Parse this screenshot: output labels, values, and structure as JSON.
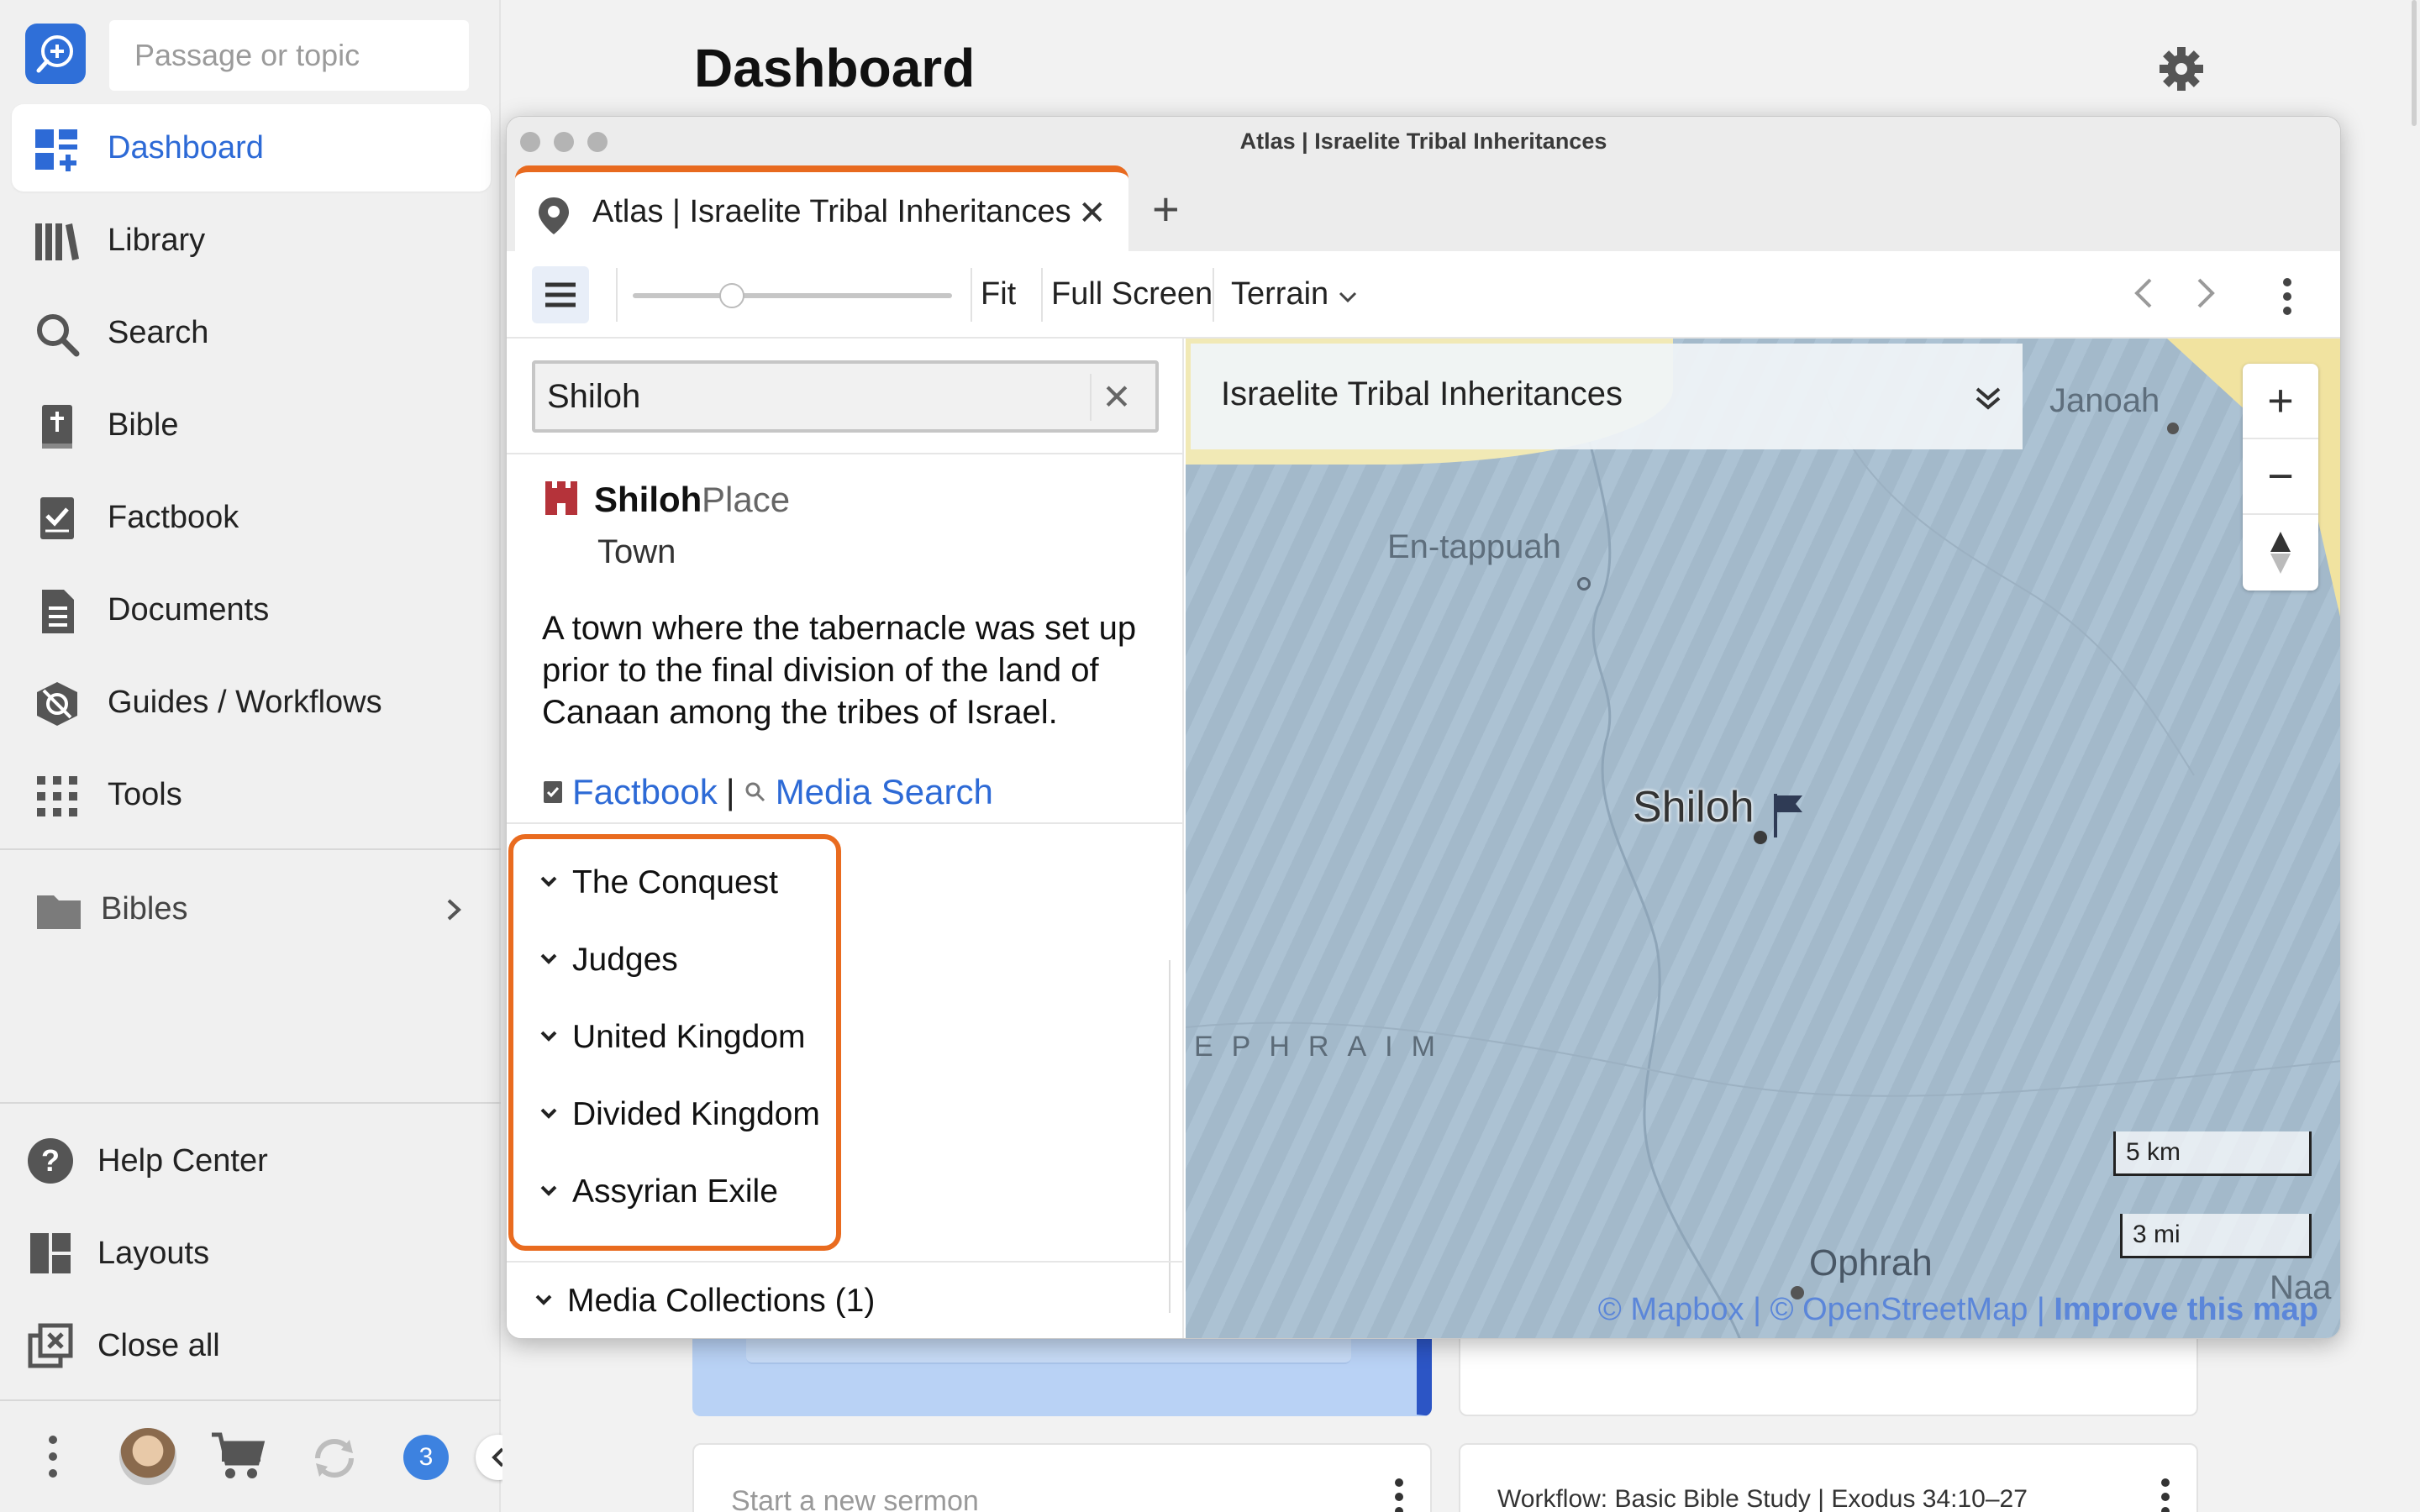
{
  "sidebar": {
    "search_placeholder": "Passage or topic",
    "nav": [
      {
        "label": "Dashboard",
        "icon": "dashboard-icon",
        "active": true
      },
      {
        "label": "Library",
        "icon": "library-icon"
      },
      {
        "label": "Search",
        "icon": "search-icon"
      },
      {
        "label": "Bible",
        "icon": "bible-icon"
      },
      {
        "label": "Factbook",
        "icon": "factbook-icon"
      },
      {
        "label": "Documents",
        "icon": "documents-icon"
      },
      {
        "label": "Guides / Workflows",
        "icon": "guides-icon"
      },
      {
        "label": "Tools",
        "icon": "tools-icon"
      }
    ],
    "bibles_label": "Bibles",
    "bottom": [
      {
        "label": "Help Center",
        "icon": "help-icon"
      },
      {
        "label": "Layouts",
        "icon": "layouts-icon"
      },
      {
        "label": "Close all",
        "icon": "close-all-icon"
      }
    ],
    "notification_count": "3"
  },
  "main": {
    "title": "Dashboard",
    "cards": {
      "sermon_placeholder": "Start a new sermon",
      "workflow_label": "Workflow: Basic Bible Study | Exodus 34:10–27"
    }
  },
  "atlas": {
    "window_title": "Atlas | Israelite Tribal Inheritances",
    "tab_label": "Atlas | Israelite Tribal Inheritances",
    "toolbar": {
      "fit": "Fit",
      "full_screen": "Full Screen",
      "terrain": "Terrain",
      "zoom_level": 0.31
    },
    "search_value": "Shiloh",
    "place": {
      "name": "Shiloh",
      "kind": "Place",
      "subtype": "Town",
      "description": "A town where the tabernacle was set up prior to the final division of the land of Canaan among the tribes of Israel.",
      "link_factbook": "Factbook",
      "link_media": "Media Search"
    },
    "sections": [
      "The Conquest",
      "Judges",
      "United Kingdom",
      "Divided Kingdom",
      "Assyrian Exile"
    ],
    "media_collections": "Media Collections (1)",
    "map": {
      "layer_title": "Israelite Tribal Inheritances",
      "labels": {
        "janoah": "Janoah",
        "entappuah": "En-tappuah",
        "shiloh": "Shiloh",
        "ephraim": "EPHRAIM",
        "ophrah": "Ophrah",
        "naa": "Naa"
      },
      "scale_km": "5 km",
      "scale_mi": "3 mi",
      "attribution_mapbox": "© Mapbox",
      "attribution_osm": "© OpenStreetMap",
      "attribution_improve": "Improve this map",
      "water_color": "#a8bfd1",
      "territory_color": "#f1e9b5"
    }
  }
}
